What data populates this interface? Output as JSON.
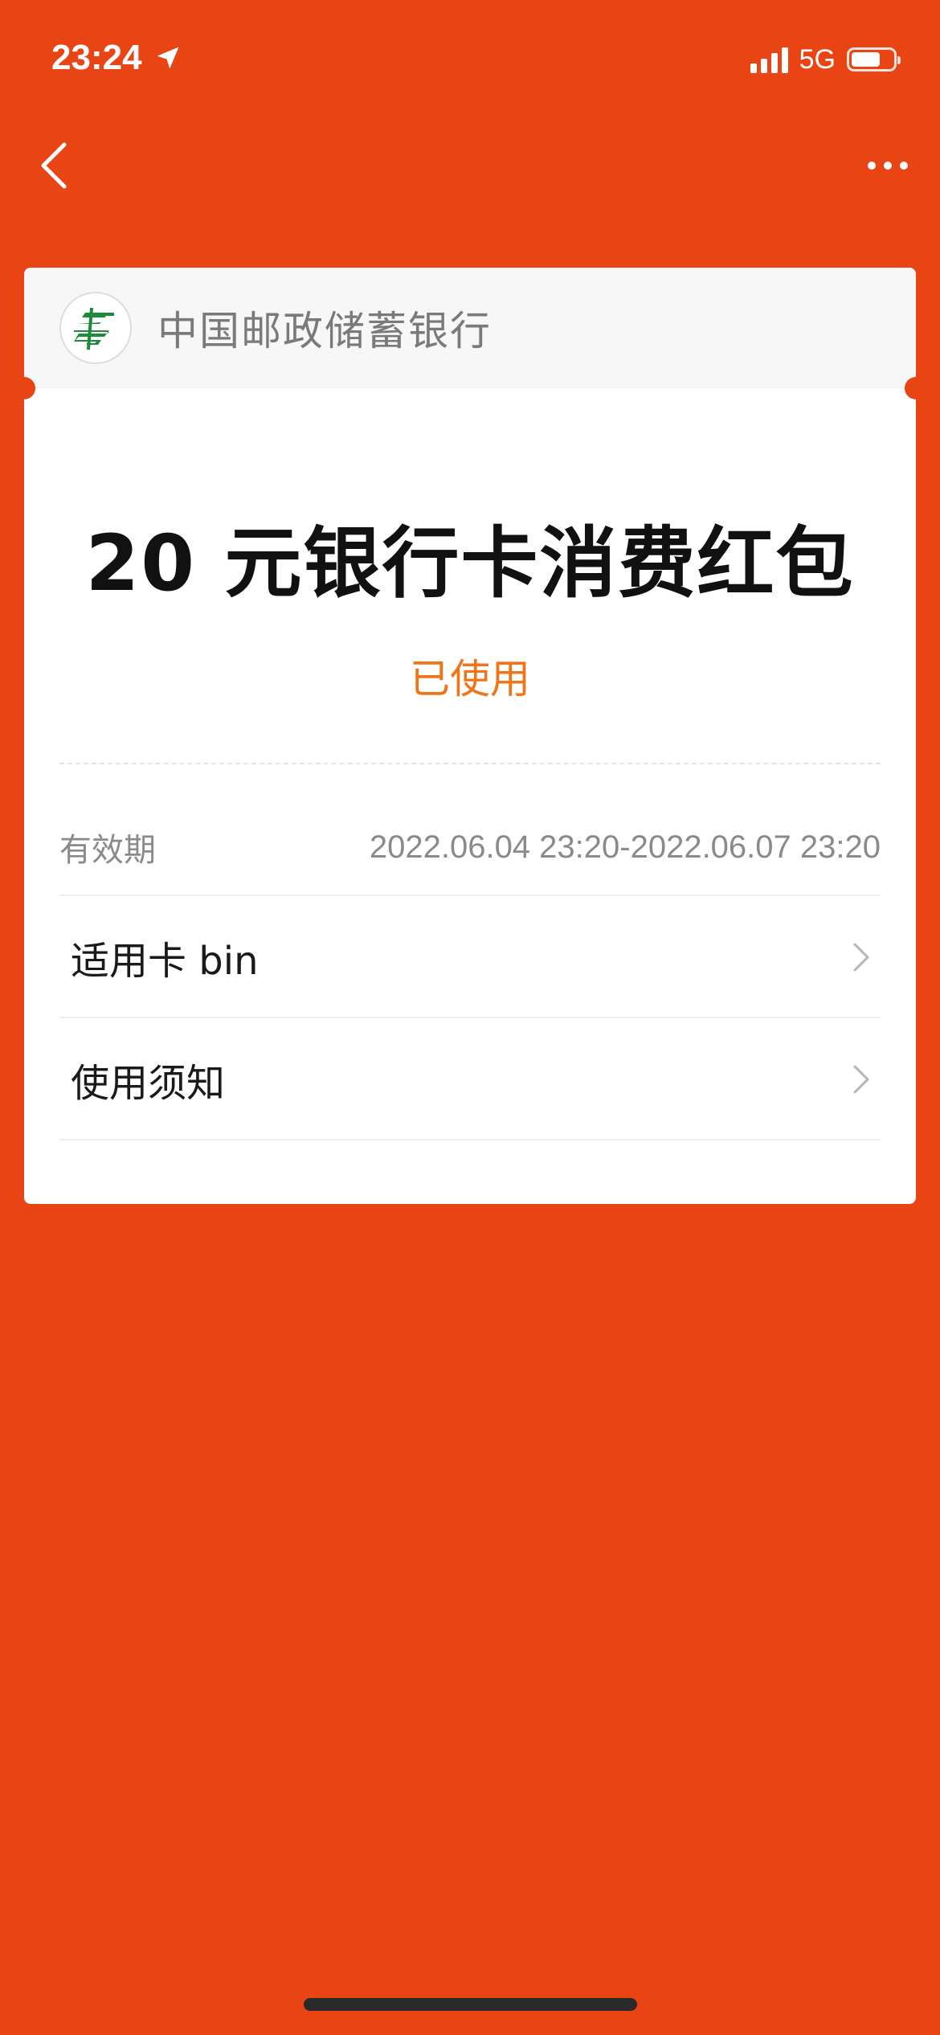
{
  "status_bar": {
    "time": "23:24",
    "network": "5G",
    "battery_level": 0.7
  },
  "nav": {
    "back_icon": "chevron-left-icon",
    "more_icon": "more-dots-icon"
  },
  "card": {
    "bank_name": "中国邮政储蓄银行",
    "bank_logo_color": "#1E8A3C",
    "coupon_title": "20 元银行卡消费红包",
    "status": "已使用",
    "status_color": "#F07418",
    "validity": {
      "label": "有效期",
      "value": "2022.06.04 23:20-2022.06.07 23:20"
    },
    "links": [
      {
        "label": "适用卡 bin"
      },
      {
        "label": "使用须知"
      }
    ]
  },
  "colors": {
    "background": "#E84414",
    "card": "#FFFFFF"
  }
}
